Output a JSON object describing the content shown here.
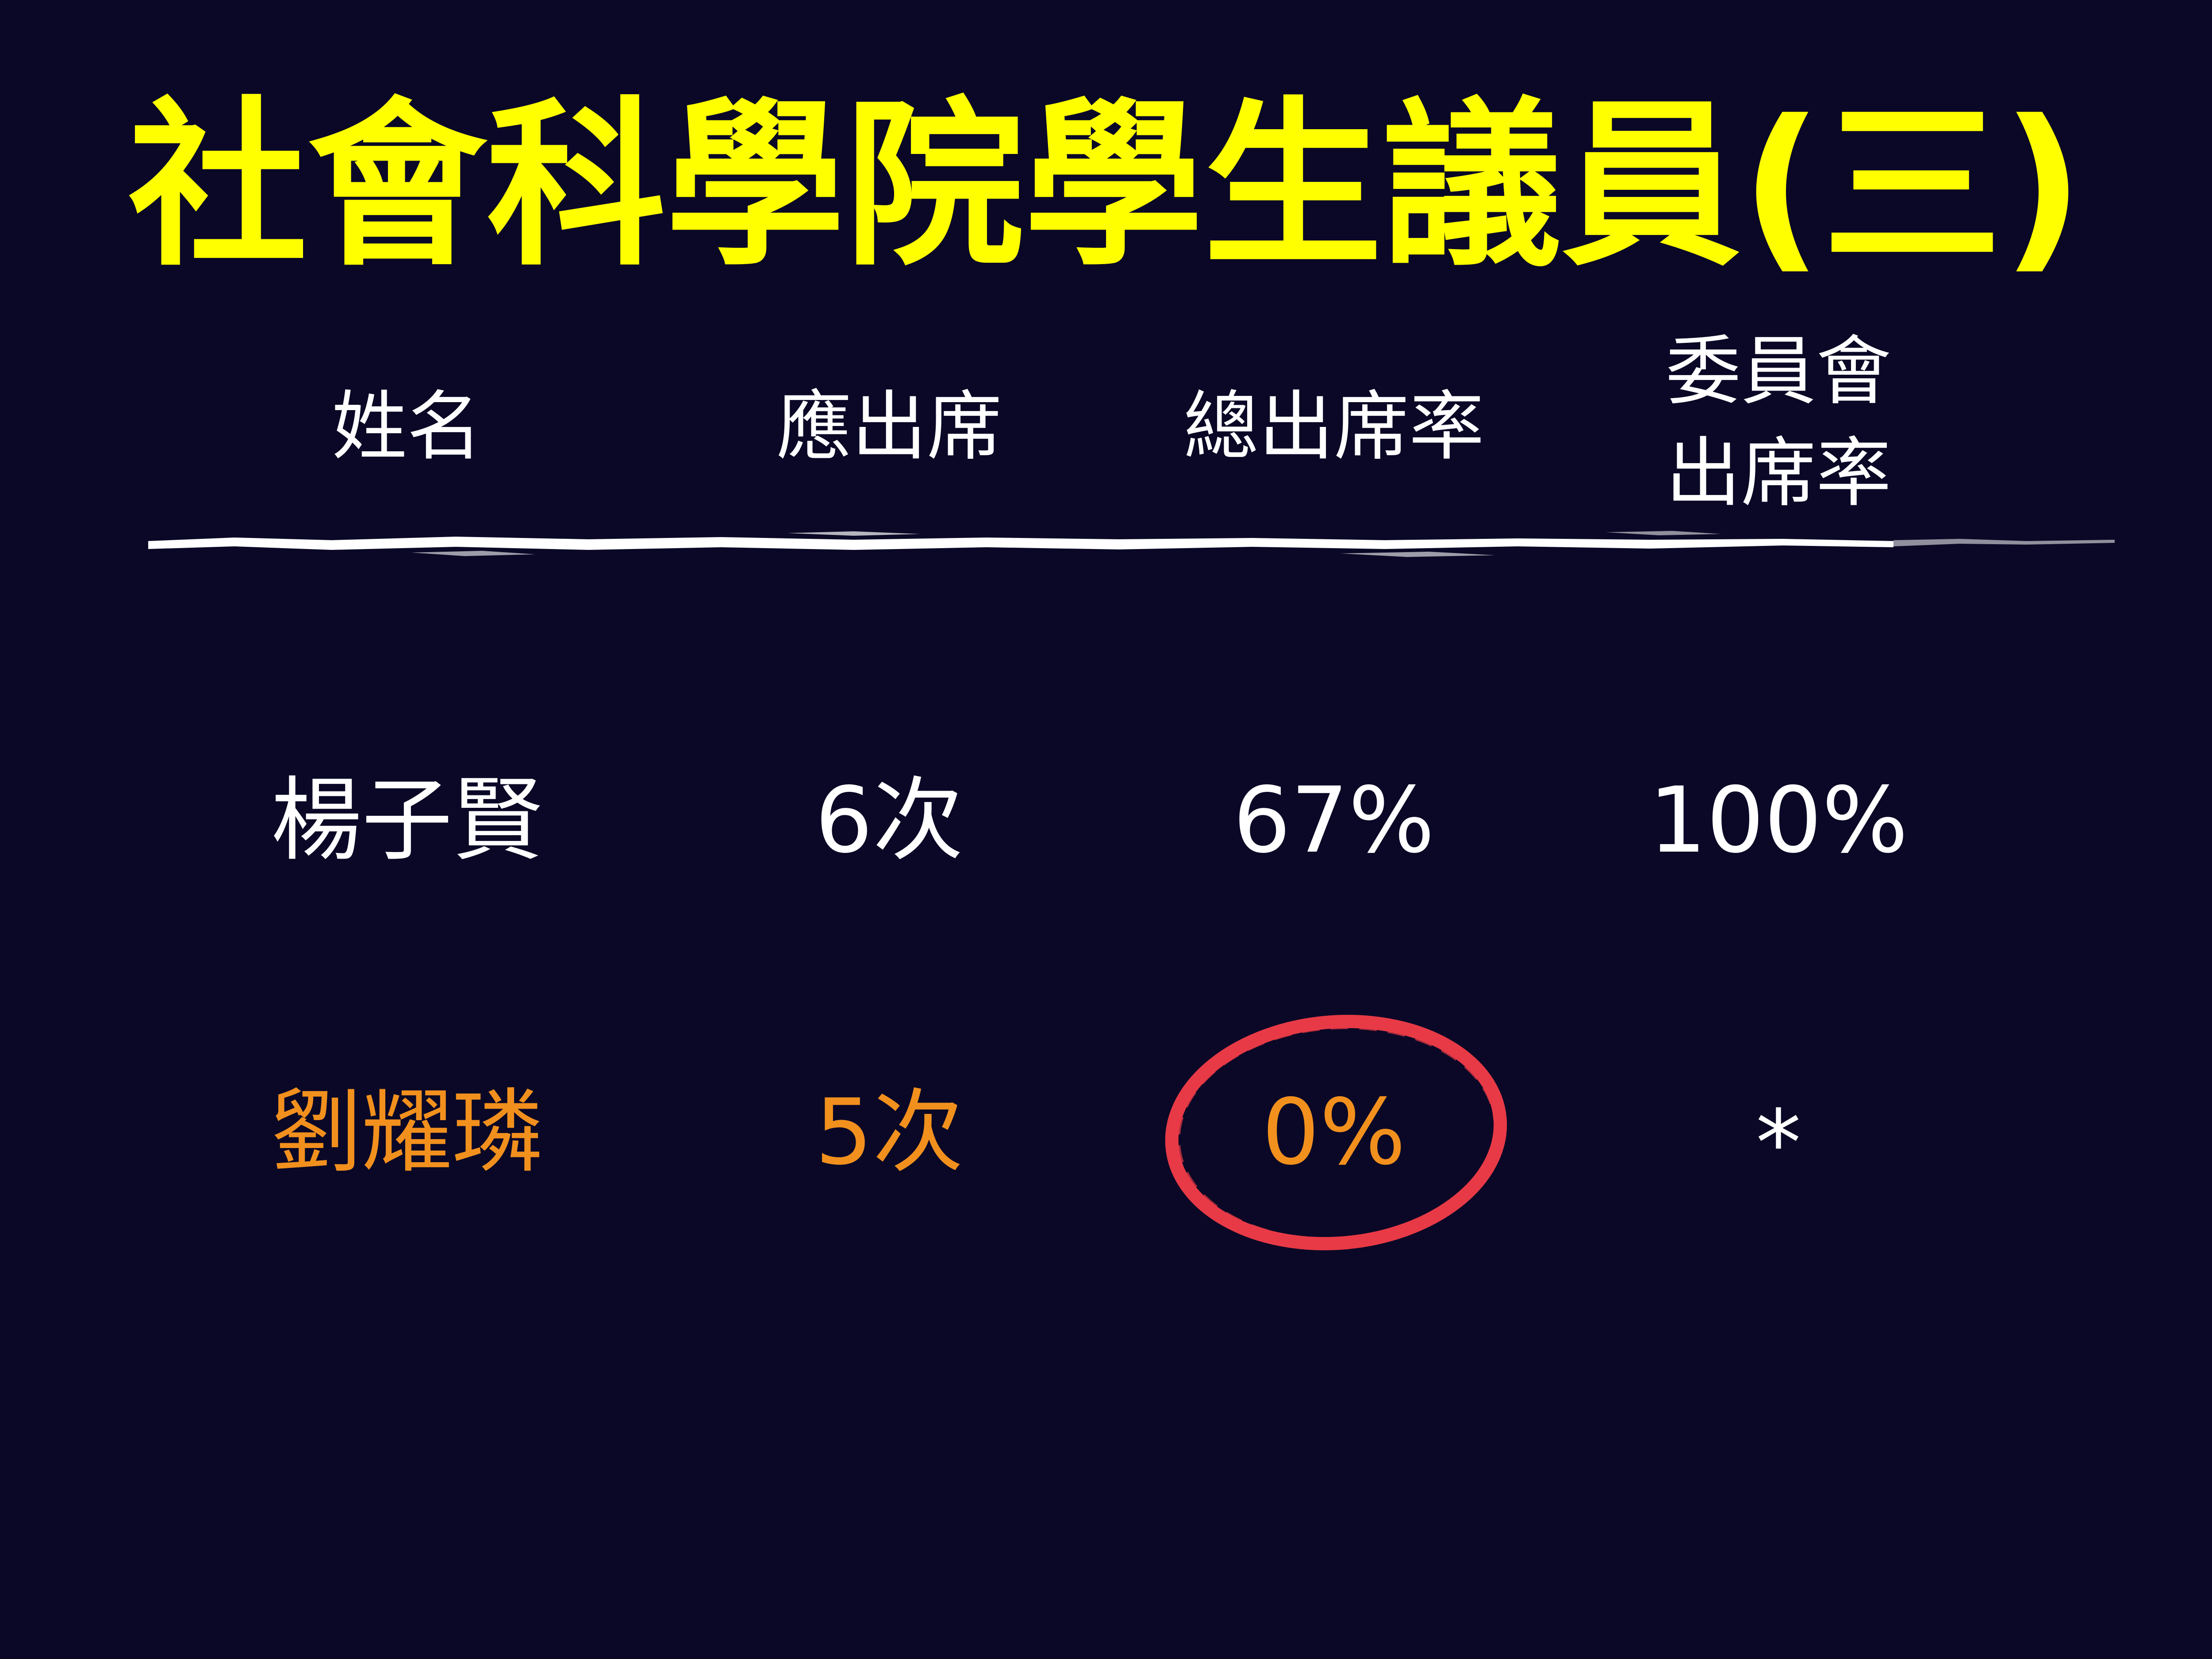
{
  "slide": {
    "title": "社會科學院學生議員(三)",
    "colors": {
      "background": "#0a0826",
      "title": "#ffff00",
      "text": "#ffffff",
      "highlight_row": "#f2901e",
      "circle": "#e83a46"
    }
  },
  "table": {
    "headers": {
      "name": "姓名",
      "required": "應出席",
      "total_rate": "總出席率",
      "committee_rate_line1": "委員會",
      "committee_rate_line2": "出席率"
    },
    "rows": [
      {
        "name": "楊子賢",
        "required": "6次",
        "total_rate": "67%",
        "committee_rate": "100%"
      },
      {
        "name": "劉耀璘",
        "required": "5次",
        "total_rate": "0%",
        "committee_rate": "*"
      }
    ]
  }
}
